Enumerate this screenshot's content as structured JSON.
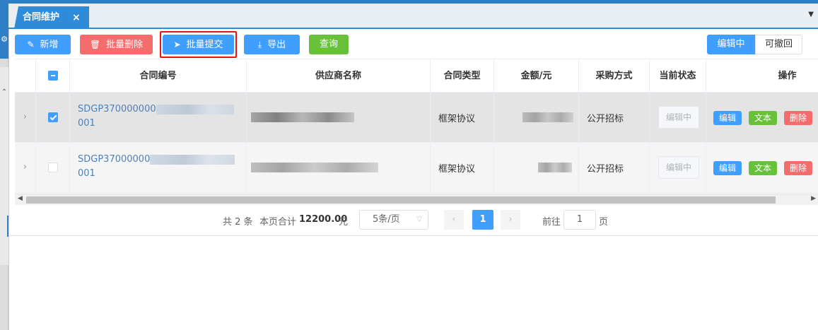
{
  "tab": {
    "title": "合同维护",
    "close": "×"
  },
  "toolbar": {
    "add": "新增",
    "batch_delete": "批量删除",
    "batch_submit": "批量提交",
    "export": "导出",
    "query": "查询"
  },
  "status_switch": {
    "editing": "编辑中",
    "revocable": "可撤回"
  },
  "table": {
    "headers": [
      "合同编号",
      "供应商名称",
      "合同类型",
      "金额/元",
      "采购方式",
      "当前状态",
      "操作"
    ],
    "rows": [
      {
        "contract_no_line1": "SDGP370000000",
        "contract_no_line2": "001",
        "contract_type": "框架协议",
        "purchase_method": "公开招标",
        "status": "编辑中",
        "selected": true,
        "actions": {
          "edit": "编辑",
          "text": "文本",
          "delete": "删除"
        }
      },
      {
        "contract_no_line1": "SDGP37000000",
        "contract_no_line2": "001",
        "contract_type": "框架协议",
        "purchase_method": "公开招标",
        "status": "编辑中",
        "selected": false,
        "actions": {
          "edit": "编辑",
          "text": "文本",
          "delete": "删除"
        }
      }
    ]
  },
  "pagination": {
    "total": "共 2 条",
    "page_sum_label": "本页合计",
    "page_sum_value": "12200.00",
    "page_sum_unit": "元",
    "page_size": "5条/页",
    "current_page": "1",
    "goto_label": "前往",
    "goto_value": "1",
    "goto_unit": "页"
  },
  "colors": {
    "primary": "#409eff",
    "danger": "#f56c6c",
    "success": "#67c23a",
    "tab": "#2f8ad8"
  },
  "icons": [
    "close-icon",
    "pencil-icon",
    "trash-icon",
    "send-icon",
    "download-icon",
    "chevron-right-icon",
    "chevron-down-icon",
    "gear-icon"
  ]
}
